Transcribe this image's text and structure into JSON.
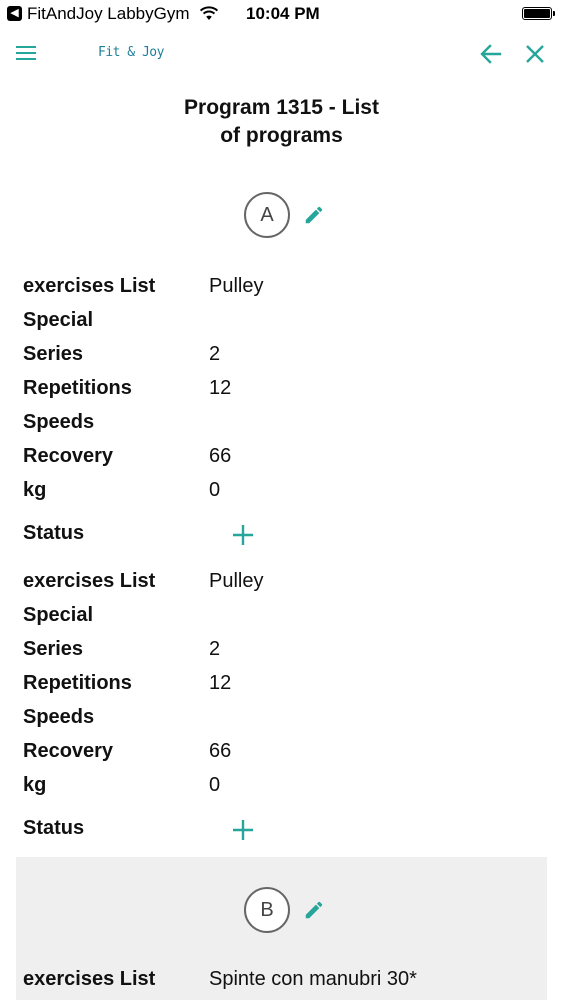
{
  "status_bar": {
    "app": "FitAndJoy LabbyGym",
    "time": "10:04 PM"
  },
  "nav": {
    "brand": "Fit & Joy"
  },
  "page": {
    "title_line1": "Program 1315 - List",
    "title_line2": "of programs"
  },
  "groups": [
    {
      "letter": "A",
      "entries": [
        {
          "exercises_label": "exercises List",
          "exercises_value": "Pulley",
          "special_label": "Special",
          "series_label": "Series",
          "series_value": "2",
          "repetitions_label": "Repetitions",
          "repetitions_value": "12",
          "speeds_label": "Speeds",
          "recovery_label": "Recovery",
          "recovery_value": "66",
          "kg_label": "kg",
          "kg_value": "0",
          "status_label": "Status"
        },
        {
          "exercises_label": "exercises List",
          "exercises_value": "Pulley",
          "special_label": "Special",
          "series_label": "Series",
          "series_value": "2",
          "repetitions_label": "Repetitions",
          "repetitions_value": "12",
          "speeds_label": "Speeds",
          "recovery_label": "Recovery",
          "recovery_value": "66",
          "kg_label": "kg",
          "kg_value": "0",
          "status_label": "Status"
        }
      ]
    },
    {
      "letter": "B",
      "entries": [
        {
          "exercises_label": "exercises List",
          "exercises_value": "Spinte con manubri 30*"
        }
      ]
    }
  ],
  "colors": {
    "accent": "#26a69a",
    "brand": "#1f7f9a",
    "panel": "#efefef"
  },
  "icons": {
    "menu": "hamburger-menu-icon",
    "back": "arrow-left-icon",
    "close": "close-icon",
    "edit": "pencil-icon",
    "add": "plus-icon",
    "wifi": "wifi-icon",
    "battery": "battery-icon"
  }
}
